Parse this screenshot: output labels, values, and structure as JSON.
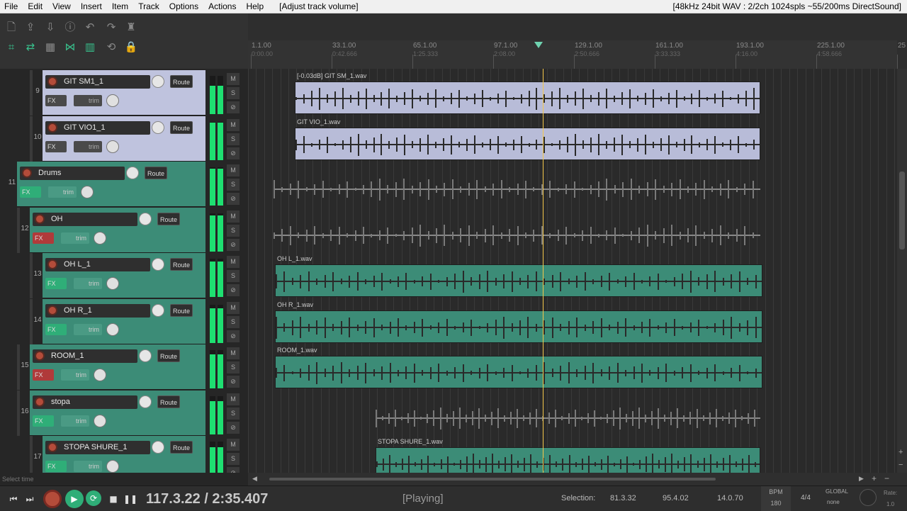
{
  "menubar": {
    "items": [
      "File",
      "Edit",
      "View",
      "Insert",
      "Item",
      "Track",
      "Options",
      "Actions",
      "Help"
    ],
    "action": "[Adjust track volume]",
    "status": "[48kHz 24bit WAV : 2/2ch 1024spls ~55/200ms DirectSound]"
  },
  "ruler": {
    "labels": [
      {
        "bar": "1.1.00",
        "time": "0:00.00"
      },
      {
        "bar": "33.1.00",
        "time": "0:42.666"
      },
      {
        "bar": "65.1.00",
        "time": "1:25.333"
      },
      {
        "bar": "97.1.00",
        "time": "2:08.00"
      },
      {
        "bar": "129.1.00",
        "time": "2:50.666"
      },
      {
        "bar": "161.1.00",
        "time": "3:33.333"
      },
      {
        "bar": "193.1.00",
        "time": "4:16.00"
      },
      {
        "bar": "225.1.00",
        "time": "4:58.666"
      },
      {
        "bar": "25",
        "time": ""
      }
    ]
  },
  "tracks": [
    {
      "num": "9",
      "name": "GIT SM1_1",
      "route": "Route",
      "fx": "FX",
      "trim": "trim",
      "color": "lav",
      "item": "[-0.03dB] GIT SM_1.wav",
      "m": "M",
      "s": "S"
    },
    {
      "num": "10",
      "name": "GIT VIO1_1",
      "route": "Route",
      "fx": "FX",
      "trim": "trim",
      "color": "lav",
      "item": "GIT VIO_1.wav",
      "m": "M",
      "s": "S"
    },
    {
      "num": "11",
      "name": "Drums",
      "route": "Route",
      "fx": "FX",
      "trim": "trim",
      "color": "teal",
      "item": "",
      "m": "M",
      "s": "S"
    },
    {
      "num": "12",
      "name": "OH",
      "route": "Route",
      "fx": "FX",
      "trim": "trim",
      "color": "teal",
      "item": "",
      "m": "M",
      "s": "S"
    },
    {
      "num": "13",
      "name": "OH L_1",
      "route": "Route",
      "fx": "FX",
      "trim": "trim",
      "color": "teal",
      "item": "OH L_1.wav",
      "m": "M",
      "s": "S"
    },
    {
      "num": "14",
      "name": "OH R_1",
      "route": "Route",
      "fx": "FX",
      "trim": "trim",
      "color": "teal",
      "item": "OH R_1.wav",
      "m": "M",
      "s": "S"
    },
    {
      "num": "15",
      "name": "ROOM_1",
      "route": "Route",
      "fx": "FX",
      "trim": "trim",
      "color": "teal",
      "item": "ROOM_1.wav",
      "m": "M",
      "s": "S"
    },
    {
      "num": "16",
      "name": "stopa",
      "route": "Route",
      "fx": "FX",
      "trim": "trim",
      "color": "teal",
      "item": "",
      "m": "M",
      "s": "S"
    },
    {
      "num": "17",
      "name": "STOPA SHURE_1",
      "route": "Route",
      "fx": "FX",
      "trim": "trim",
      "color": "teal",
      "item": "STOPA SHURE_1.wav",
      "m": "M",
      "s": "S"
    }
  ],
  "transport": {
    "position": "117.3.22 / 2:35.407",
    "state": "[Playing]",
    "selection_label": "Selection:",
    "sel_start": "81.3.32",
    "sel_end": "95.4.02",
    "sel_len": "14.0.70",
    "bpm_label": "BPM",
    "bpm": "180",
    "timesig": "4/4",
    "global_label": "GLOBAL",
    "global_value": "none",
    "rate_label": "Rate:",
    "rate": "1.0"
  },
  "footer": {
    "select_time": "Select time"
  },
  "colors": {
    "teal": "#3c8c77",
    "lavender": "#bfc3de",
    "meter": "#1ee071",
    "playhead": "#f5c84b"
  }
}
